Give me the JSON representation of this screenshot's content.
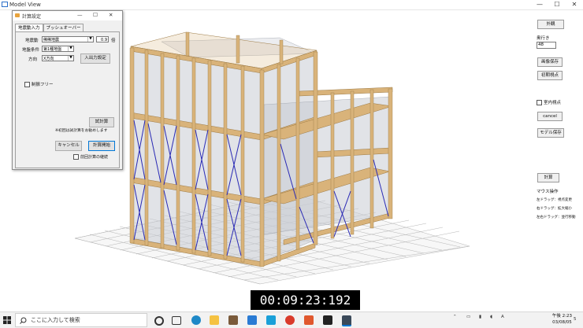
{
  "window": {
    "title": "Model View",
    "minimize": "—",
    "maximize": "☐",
    "close": "✕"
  },
  "right_panel": {
    "btn_exterior": "外観",
    "depth_label": "奥行き",
    "depth_value": "48",
    "btn_save_image": "画像保存",
    "btn_initial_view": "初期視点",
    "indoor_view_label": "室内視点",
    "btn_cancel": "cancel",
    "btn_save_model": "モデル保存",
    "btn_calculate": "計算",
    "mouse_title": "マウス操作",
    "mouse_left": "左ドラッグ：視点変更",
    "mouse_right": "右ドラッグ：拡大縮小",
    "mouse_both": "左右ドラッグ：並行移動"
  },
  "dialog": {
    "title": "計算設定",
    "minimize": "—",
    "maximize": "☐",
    "close": "✕",
    "tabs": [
      "地震動入力",
      "プッシュオーバー"
    ],
    "seismic_label": "地震動",
    "seismic_value": "稀稀地震",
    "scale_value": "0.9",
    "scale_unit": "倍",
    "ground_label": "地盤条件",
    "ground_value": "第1種地盤",
    "direction_label": "方向",
    "direction_value": "X方向",
    "btn_io_settings": "入出力設定",
    "brace_free_label": "制振フリー",
    "btn_recalc": "試計算",
    "note": "※初回は試計算をお勧めします",
    "btn_cancel": "キャンセル",
    "btn_start": "計算開始",
    "continue_label": "前回計算の継続"
  },
  "timecode": "00:09:23:192",
  "taskbar": {
    "search_placeholder": "ここに入力して検索",
    "time": "午後 2:23",
    "date": "03/08/05",
    "notification_count": "5"
  },
  "colors": {
    "wood": "#d9b37a",
    "wood_edge": "#9c7a45",
    "brace": "#2a2ab5",
    "wall": "#c9ccd3",
    "accent": "#0078d7"
  },
  "icons": [
    "windows-start-icon",
    "search-icon",
    "cortana-icon",
    "task-view-icon",
    "edge-icon",
    "file-explorer-icon",
    "store-icon",
    "mail-icon",
    "app-icon",
    "chrome-icon",
    "app-icon",
    "app-icon"
  ]
}
